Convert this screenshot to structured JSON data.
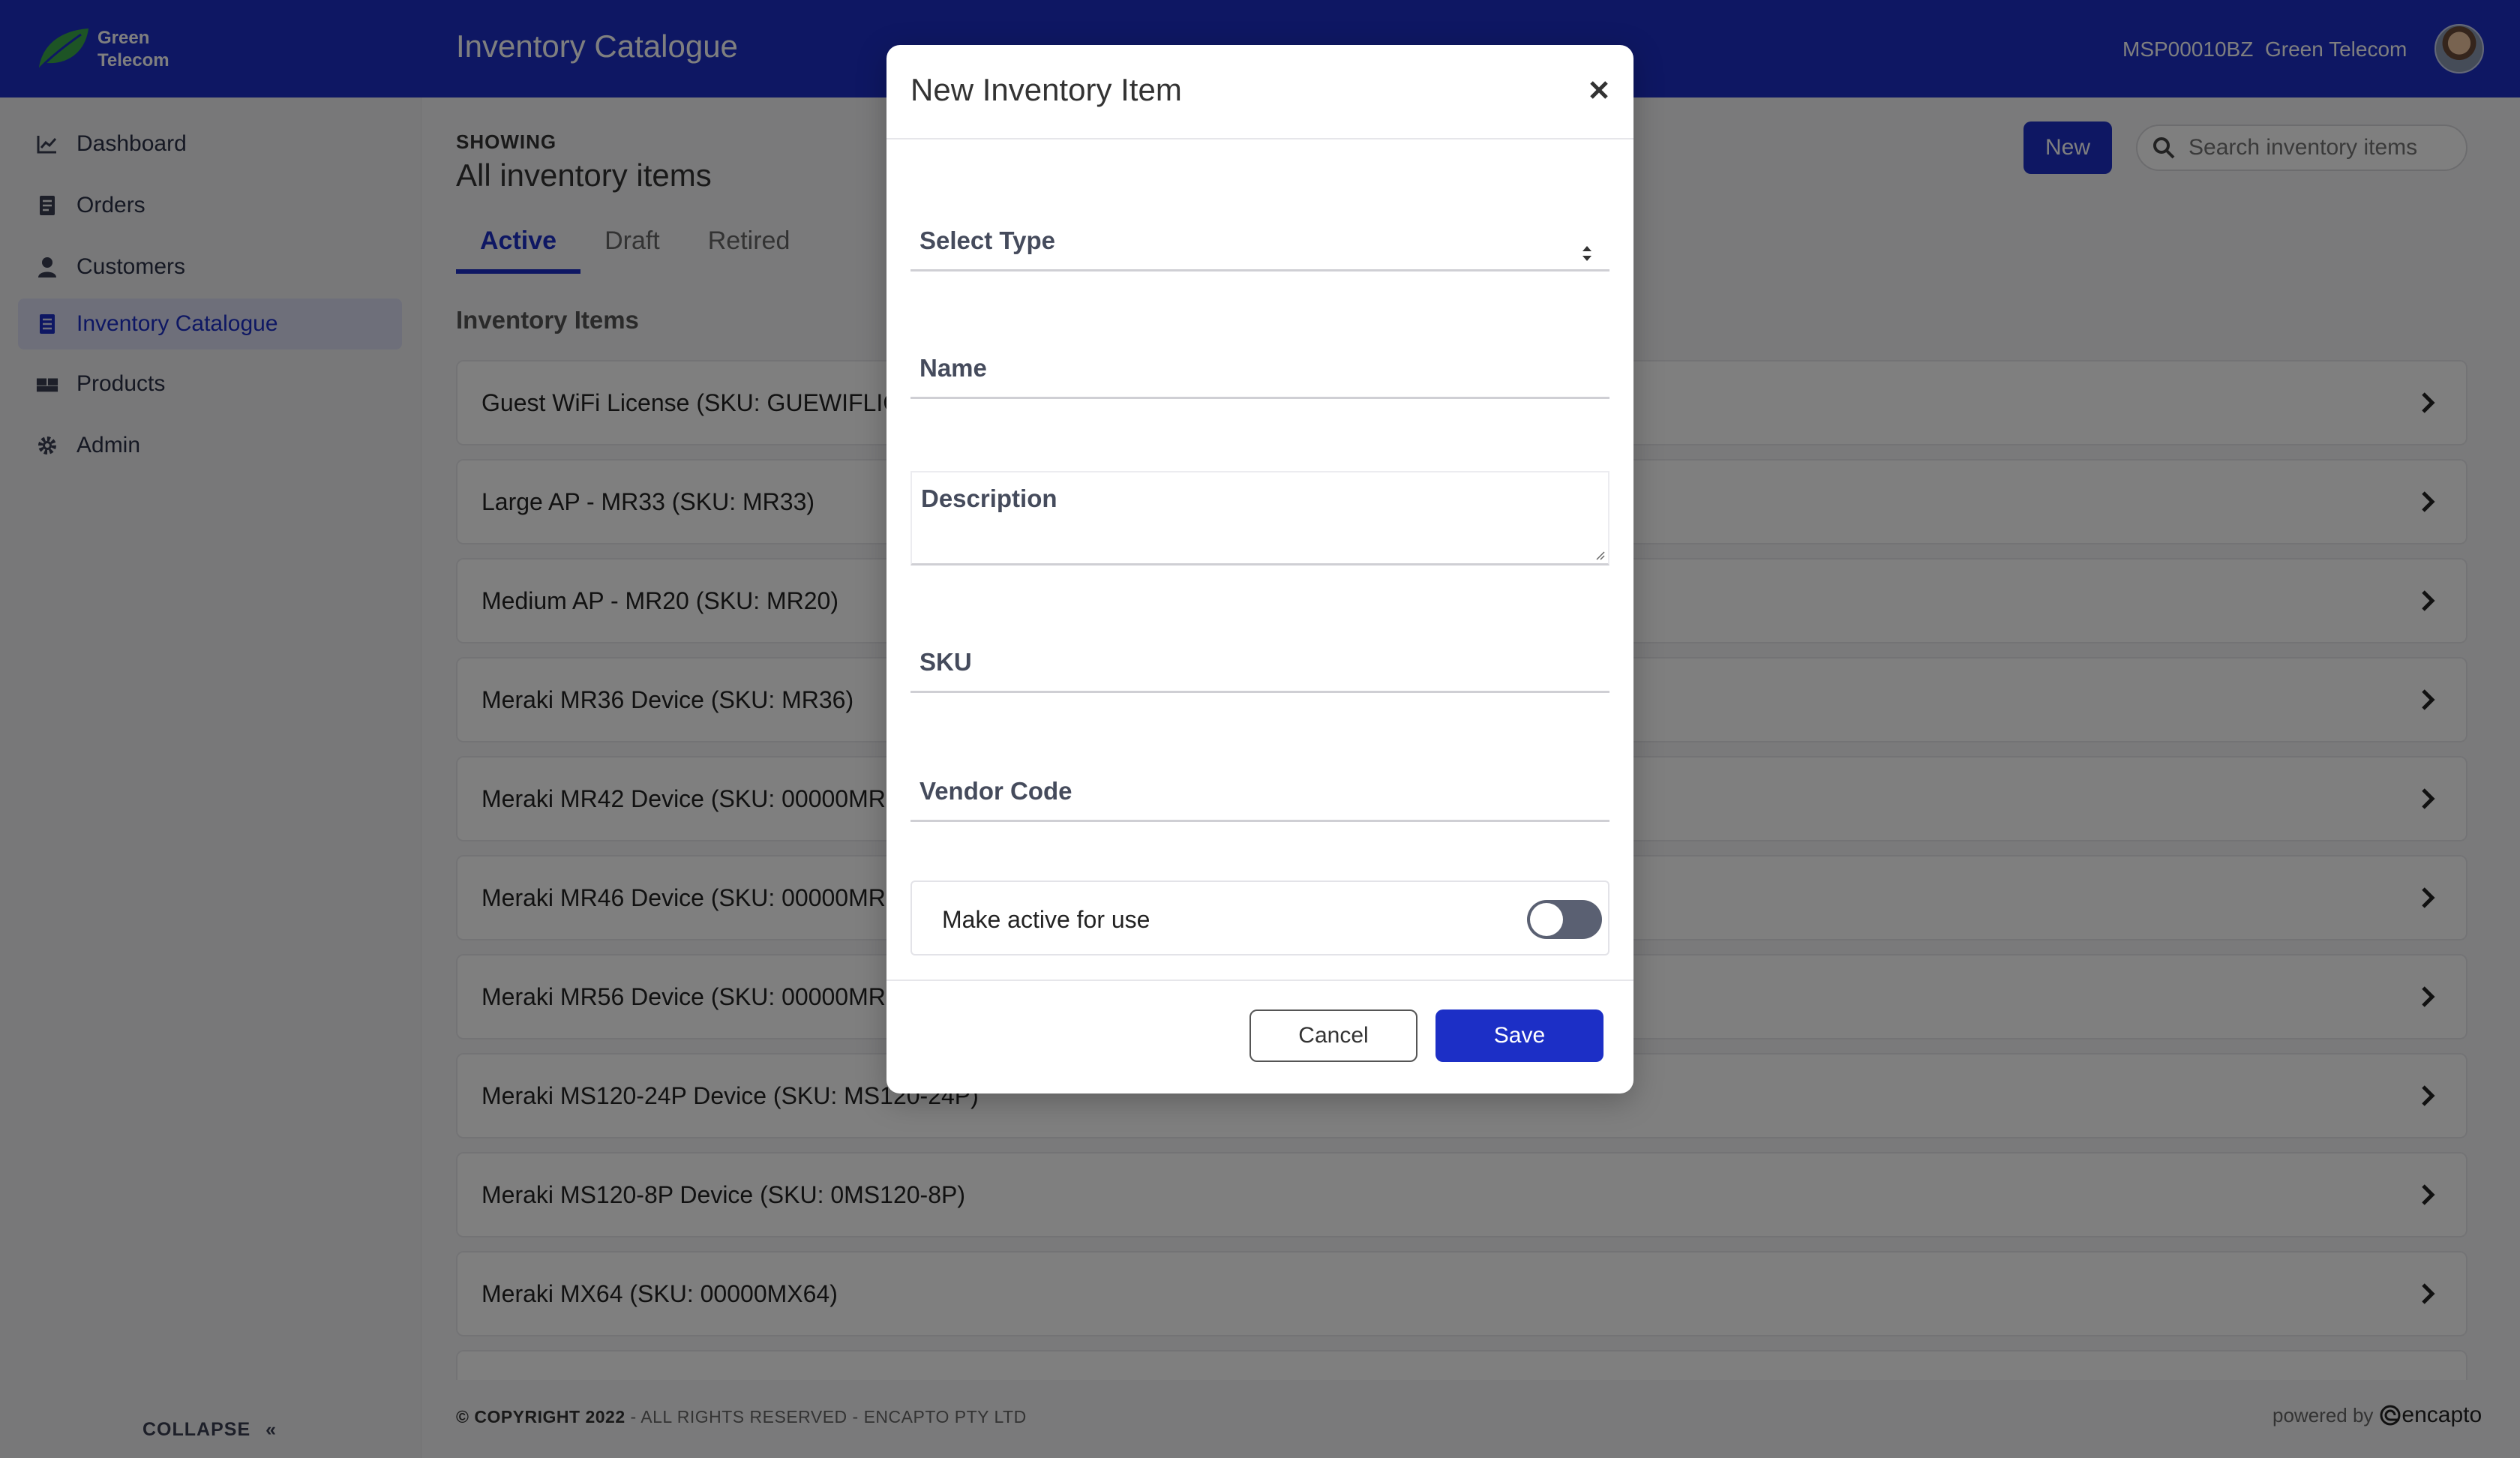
{
  "brand": {
    "line1": "Green",
    "line2": "Telecom"
  },
  "header": {
    "title": "Inventory Catalogue",
    "account_id": "MSP00010BZ",
    "account_name": "Green Telecom"
  },
  "sidebar": {
    "items": [
      {
        "label": "Dashboard",
        "icon": "chart-line-icon"
      },
      {
        "label": "Orders",
        "icon": "receipt-icon"
      },
      {
        "label": "Customers",
        "icon": "user-icon"
      },
      {
        "label": "Inventory Catalogue",
        "icon": "file-list-icon",
        "active": true
      },
      {
        "label": "Products",
        "icon": "boxes-icon"
      },
      {
        "label": "Admin",
        "icon": "gear-icon"
      }
    ],
    "collapse_label": "COLLAPSE"
  },
  "main": {
    "showing_label": "SHOWING",
    "subtitle": "All inventory items",
    "tabs": [
      {
        "label": "Active",
        "active": true
      },
      {
        "label": "Draft"
      },
      {
        "label": "Retired"
      }
    ],
    "section_title": "Inventory Items",
    "new_label": "New",
    "search_placeholder": "Search inventory items",
    "items": [
      "Guest WiFi License (SKU: GUEWIFLIC",
      "Large AP - MR33 (SKU: MR33)",
      "Medium AP - MR20 (SKU: MR20)",
      "Meraki MR36 Device (SKU: MR36)",
      "Meraki MR42 Device (SKU: 00000MR",
      "Meraki MR46 Device (SKU: 00000MR",
      "Meraki MR56 Device (SKU: 00000MR",
      "Meraki MS120-24P Device (SKU: MS120-24P)",
      "Meraki MS120-8P Device (SKU: 0MS120-8P)",
      "Meraki MX64 (SKU: 00000MX64)"
    ]
  },
  "footer": {
    "copyright_bold": "© COPYRIGHT 2022",
    "copyright_rest": " - ALL RIGHTS RESERVED - ENCAPTO PTY LTD",
    "powered_by": "powered by",
    "vendor": "encapto"
  },
  "modal": {
    "title": "New Inventory Item",
    "select_type_label": "Select Type",
    "name_label": "Name",
    "description_label": "Description",
    "sku_label": "SKU",
    "vendor_code_label": "Vendor Code",
    "toggle_label": "Make active for use",
    "toggle_on": false,
    "cancel_label": "Cancel",
    "save_label": "Save"
  },
  "colors": {
    "primary": "#1c2fc6",
    "logo_green": "#3aa84a",
    "overlay": "rgba(0,0,0,0.5)"
  }
}
